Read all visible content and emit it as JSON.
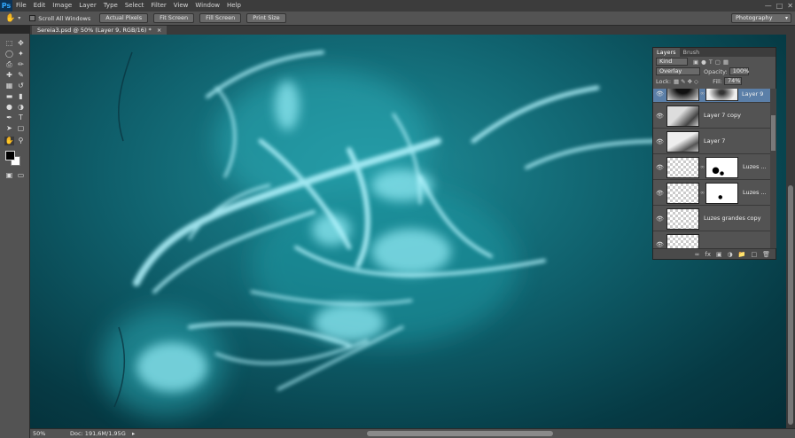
{
  "app": {
    "logo": "Ps"
  },
  "menu": [
    "File",
    "Edit",
    "Image",
    "Layer",
    "Type",
    "Select",
    "Filter",
    "View",
    "Window",
    "Help"
  ],
  "options": {
    "scroll_all_label": "Scroll All Windows",
    "buttons": [
      "Actual Pixels",
      "Fit Screen",
      "Fill Screen",
      "Print Size"
    ],
    "workspace": "Photography"
  },
  "document": {
    "tab_title": "Sereia3.psd @ 50% (Layer 9, RGB/16) *"
  },
  "status": {
    "zoom": "50%",
    "doc": "Doc: 191,6M/1,95G"
  },
  "layers_panel": {
    "tabs": [
      "Layers",
      "Brush"
    ],
    "filter": "Kind",
    "blend_mode": "Overlay",
    "opacity_label": "Opacity:",
    "opacity": "100%",
    "lock_label": "Lock:",
    "fill_label": "Fill:",
    "fill": "74%",
    "layers": [
      {
        "name": "Layer 9",
        "selected": true,
        "mask": true
      },
      {
        "name": "Layer 7 copy",
        "selected": false,
        "mask": false
      },
      {
        "name": "Layer 7",
        "selected": false,
        "mask": false
      },
      {
        "name": "Luzes ...",
        "selected": false,
        "mask": true
      },
      {
        "name": "Luzes ...",
        "selected": false,
        "mask": true
      },
      {
        "name": "Luzes grandes copy",
        "selected": false,
        "mask": false
      }
    ]
  },
  "colors": {
    "canvas_teal": "#0f5f6b",
    "highlight": "#a8f4ff",
    "selected_layer": "#5b7fa8"
  }
}
